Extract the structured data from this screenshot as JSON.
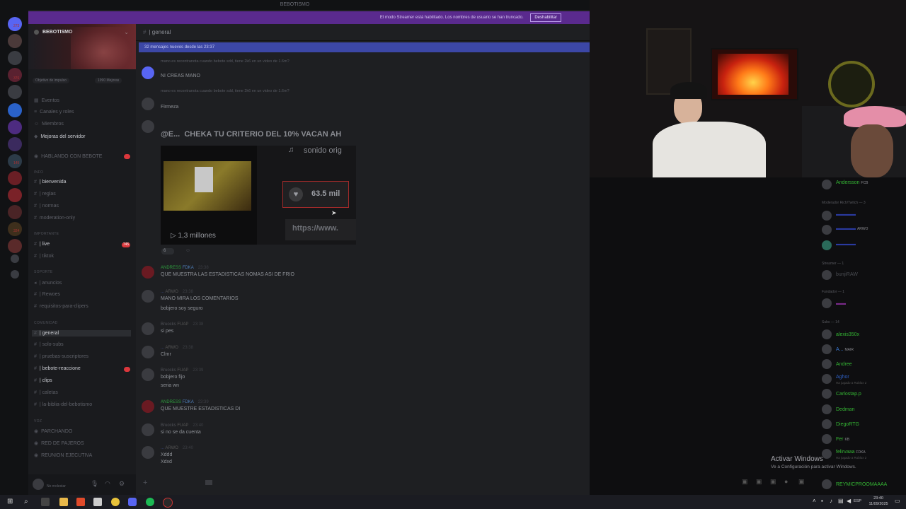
{
  "discord": {
    "title": "BEBOTISMO",
    "banner_text": "El modo Streamer está habilitado. Los nombres de usuario se han truncado.",
    "banner_button": "Deshabilitar",
    "server_badges": [
      "273",
      "376",
      "145",
      "324"
    ],
    "guild_name": "BEBOTISMO",
    "chips": [
      "Objetivo de impulso",
      "1990 Mejoras"
    ],
    "sidebar": {
      "top_items": [
        "Eventos",
        "Canales y roles",
        "Miembros",
        "Mejoras del servidor"
      ],
      "hablando": "HABLANDO CON BEBOTE",
      "cat_info": "INFO",
      "info_channels": [
        "| bienvenida",
        "| reglas",
        "| normas",
        "moderation-only"
      ],
      "cat_importante": "IMPORTANTE",
      "importante_channels": [
        "| live",
        "| tiktok"
      ],
      "live_badge": "745",
      "cat_soporte": "SOPORTE",
      "soporte_channels": [
        "| anuncios",
        "| Rewoes",
        "requisitos-para-clipers"
      ],
      "cat_comunidad": "COMUNIDAD",
      "comunidad_channels": [
        "| general",
        "| solo-subs",
        "| pruebas-suscriptores",
        "| bebote-reaccione",
        "| clips",
        "| caletas",
        "| la-biblia-del-bebotismo"
      ],
      "cat_voice": "VOZ",
      "voice_channels": [
        "PARCHANDO",
        "RED DE PAJEROS",
        "REUNION EJECUTIVA"
      ],
      "user_status": "No molestar"
    },
    "chat": {
      "channel": "| general",
      "new_messages_bar": "32 mensajes nuevos desde las 23:37",
      "reply1": "mano es recontranota cuando bebote sdd, tiene 2k6 en un video de 1.6m?",
      "msg1_text": "NI CREAS MANO",
      "reply2": "mano es recontranota cuando bebote sdd, tiene 2k6 en un video de 1.6m?",
      "msg2_text": "Firmeza",
      "embed_title_prefix": "@E...",
      "embed_title": "CHEKA TU CRITERIO DEL 10%  VACAN AH",
      "embed_sonido": "sonido orig",
      "embed_likes": "63.5 mil",
      "embed_views": "▷ 1,3 millones",
      "embed_url": "https://www.",
      "reaction_count": "6",
      "messages": [
        {
          "name": "ANDRESS",
          "tag": "FDKA",
          "time": "23:38",
          "text": "QUE MUESTRA LAS ESTADISTICAS NOMAS ASI DE FRIO",
          "color": "green"
        },
        {
          "name": "...",
          "tag": "ARWO",
          "time": "23:38",
          "text": "MANO MIRA LOS COMENTARIOS",
          "text2": "bobjero soy seguro",
          "color": "blue"
        },
        {
          "name": "Bruocks",
          "tag": "FUAP",
          "time": "23:38",
          "text": "si pes",
          "color": "dim"
        },
        {
          "name": "...",
          "tag": "ARWO",
          "time": "23:38",
          "text": "Clmr",
          "color": "blue"
        },
        {
          "name": "Bruocks",
          "tag": "FUAP",
          "time": "23:39",
          "text": "bobjero fijo",
          "text2": "seria wn",
          "color": "dim"
        },
        {
          "name": "ANDRESS",
          "tag": "FDKA",
          "time": "23:39",
          "text": "QUE MUESTRE ESTADISTICAS DI",
          "color": "green"
        },
        {
          "name": "Bruocks",
          "tag": "FUAP",
          "time": "23:40",
          "text": "si no se da cuenta",
          "color": "dim"
        },
        {
          "name": "...",
          "tag": "ARWO",
          "time": "23:40",
          "text": "Xddd",
          "text2": "Xdxd",
          "color": "blue"
        }
      ]
    }
  },
  "twitch_chat": {
    "top_user": "Andersson",
    "top_tag": "FCB",
    "section_mods": "Moderador Rich/Twitch — 3",
    "mod_badge": "ARWO",
    "section_vip": "Streamer — 1",
    "vip_user": "bunjiRAW",
    "section_founder": "Fundador — 1",
    "section_subs": "Subs — 14",
    "users": [
      {
        "name": "alexis350x",
        "color": "#35b534"
      },
      {
        "name": "A...",
        "tag": "MAIR",
        "color": "#3a7ad6"
      },
      {
        "name": "Andree",
        "color": "#35b534"
      },
      {
        "name": "Aghor",
        "sub": "Ha jugado a Roblox 2",
        "color": "#2f62c7"
      },
      {
        "name": "Carlostap.p",
        "color": "#35b534"
      },
      {
        "name": "Dedman",
        "color": "#35b534"
      },
      {
        "name": "DiegoRTG",
        "color": "#35b534"
      },
      {
        "name": "Fer",
        "tag": "KB",
        "color": "#35b534"
      },
      {
        "name": "felirvaaa",
        "tag": "FDKA",
        "sub": "Ha jugado a Roblox 2",
        "color": "#35b534"
      },
      {
        "name": "REYMICPROOMAAAA",
        "color": "#35b534"
      }
    ]
  },
  "watermark": {
    "line1": "Activar Windows",
    "line2": "Ve a Configuración para activar Windows."
  },
  "taskbar": {
    "lang": "ESP",
    "time": "23:40",
    "date": "11/09/2025"
  }
}
